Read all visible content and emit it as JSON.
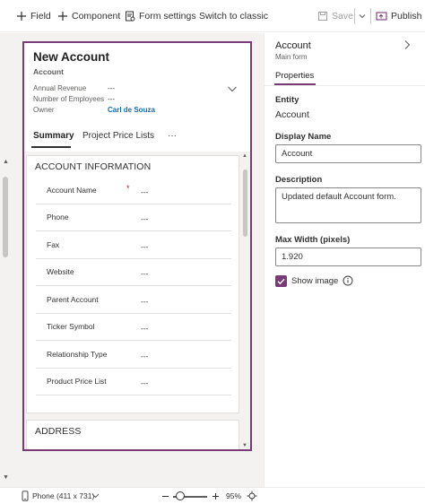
{
  "toolbar": {
    "field_label": "Field",
    "component_label": "Component",
    "form_settings_label": "Form settings",
    "switch_classic_label": "Switch to classic",
    "save_label": "Save",
    "publish_label": "Publish"
  },
  "form": {
    "title": "New Account",
    "entity": "Account",
    "header_fields": [
      {
        "label": "Annual Revenue",
        "value": "---"
      },
      {
        "label": "Number of Employees",
        "value": "---"
      },
      {
        "label": "Owner",
        "value": "Carl de Souza"
      }
    ],
    "tabs": [
      "Summary",
      "Project Price Lists",
      "···"
    ],
    "sections": [
      {
        "title": "ACCOUNT INFORMATION",
        "fields": [
          {
            "label": "Account Name",
            "required": "*",
            "value": "---"
          },
          {
            "label": "Phone",
            "value": "---"
          },
          {
            "label": "Fax",
            "value": "---"
          },
          {
            "label": "Website",
            "value": "---"
          },
          {
            "label": "Parent Account",
            "value": "---"
          },
          {
            "label": "Ticker Symbol",
            "value": "---"
          },
          {
            "label": "Relationship Type",
            "value": "---"
          },
          {
            "label": "Product Price List",
            "value": "---"
          }
        ]
      },
      {
        "title": "ADDRESS"
      }
    ]
  },
  "panel": {
    "title": "Account",
    "subtitle": "Main form",
    "tab": "Properties",
    "entity_label": "Entity",
    "entity_value": "Account",
    "display_name_label": "Display Name",
    "display_name_value": "Account",
    "description_label": "Description",
    "description_value": "Updated default Account form.",
    "max_width_label": "Max Width (pixels)",
    "max_width_value": "1.920",
    "show_image_label": "Show image",
    "show_image_checked": true
  },
  "statusbar": {
    "device_label": "Phone (411 x 731)",
    "zoom_label": "95%",
    "zoom_level": 0.95
  },
  "colors": {
    "accent": "#7a3a78",
    "link": "#0f6cbd",
    "required": "#a4262c"
  }
}
